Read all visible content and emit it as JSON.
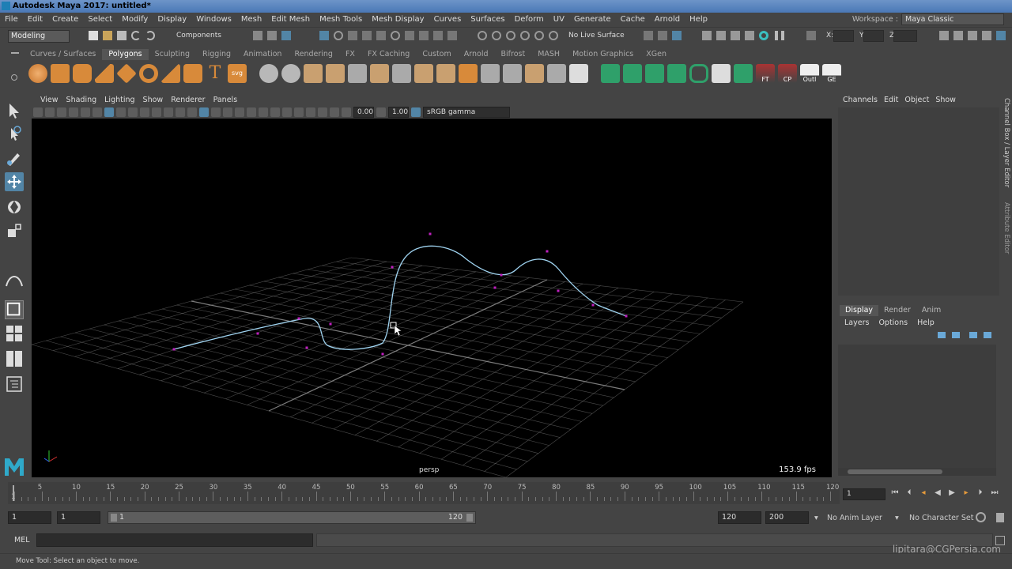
{
  "window": {
    "title": "Autodesk Maya 2017: untitled*"
  },
  "menubar": {
    "items": [
      "File",
      "Edit",
      "Create",
      "Select",
      "Modify",
      "Display",
      "Windows",
      "Mesh",
      "Edit Mesh",
      "Mesh Tools",
      "Mesh Display",
      "Curves",
      "Surfaces",
      "Deform",
      "UV",
      "Generate",
      "Cache",
      "Arnold",
      "Help"
    ]
  },
  "workspace": {
    "label": "Workspace :",
    "value": "Maya Classic"
  },
  "statusline": {
    "menu_set": "Modeling",
    "selection_mode": "Components",
    "live_surface": "No Live Surface",
    "x_label": "X:",
    "y_label": "Y:",
    "z_label": "Z:"
  },
  "shelf": {
    "tabs": [
      "Curves / Surfaces",
      "Polygons",
      "Sculpting",
      "Rigging",
      "Animation",
      "Rendering",
      "FX",
      "FX Caching",
      "Custom",
      "Arnold",
      "Bifrost",
      "MASH",
      "Motion Graphics",
      "XGen"
    ],
    "active_tab": "Polygons",
    "labeled_icons": [
      "FT",
      "CP",
      "Outl",
      "GE"
    ]
  },
  "viewport": {
    "menu": [
      "View",
      "Shading",
      "Lighting",
      "Show",
      "Renderer",
      "Panels"
    ],
    "exposure": "0.00",
    "gamma": "1.00",
    "color_space": "sRGB gamma",
    "camera": "persp",
    "fps": "153.9 fps"
  },
  "channel_box": {
    "menu": [
      "Channels",
      "Edit",
      "Object",
      "Show"
    ],
    "side_tabs": [
      "Channel Box / Layer Editor",
      "Attribute Editor"
    ]
  },
  "layer_editor": {
    "tabs": [
      "Display",
      "Render",
      "Anim"
    ],
    "active_tab": "Display",
    "menu": [
      "Layers",
      "Options",
      "Help"
    ]
  },
  "timeslider": {
    "ticks": [
      "1",
      "5",
      "10",
      "15",
      "20",
      "25",
      "30",
      "35",
      "40",
      "45",
      "50",
      "55",
      "60",
      "65",
      "70",
      "75",
      "80",
      "85",
      "90",
      "95",
      "100",
      "105",
      "110",
      "115",
      "120"
    ],
    "current_frame": "1"
  },
  "range": {
    "start": "1",
    "playback_start": "1",
    "slider_start": "1",
    "slider_end": "120",
    "playback_end": "120",
    "end": "200",
    "anim_layer": "No Anim Layer",
    "character_set": "No Character Set"
  },
  "cmdline": {
    "label": "MEL"
  },
  "helpline": {
    "text": "Move Tool: Select an object to move."
  },
  "watermark": {
    "text": "lipitara@CGPersia.com"
  },
  "colors": {
    "curve": "#9fd3f0",
    "cv_point": "#c020c0",
    "grid": "#8a8a8a",
    "accent": "#5285a6"
  }
}
